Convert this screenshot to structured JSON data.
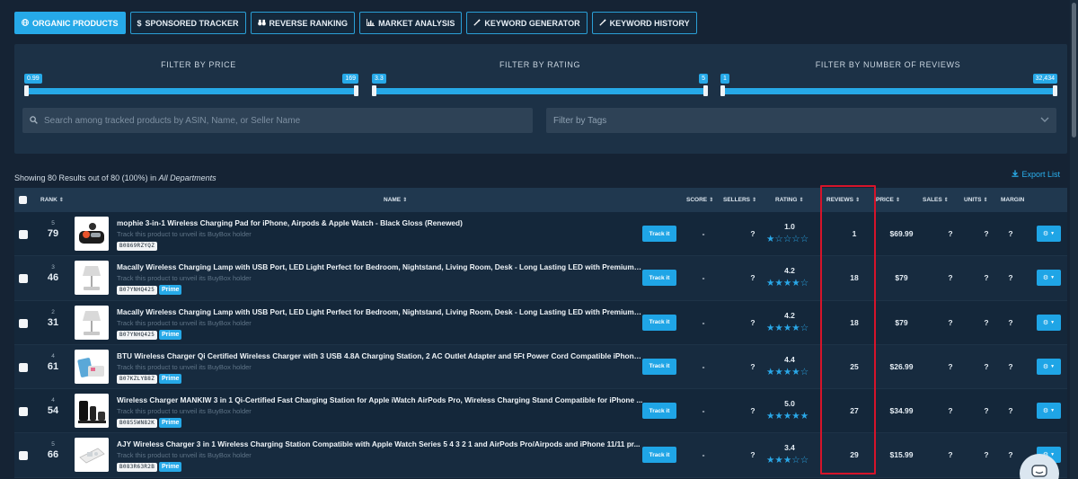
{
  "tabs": [
    {
      "label": "ORGANIC PRODUCTS",
      "icon": "globe-icon",
      "active": true
    },
    {
      "label": "SPONSORED TRACKER",
      "icon": "dollar-icon",
      "active": false
    },
    {
      "label": "REVERSE RANKING",
      "icon": "binoculars-icon",
      "active": false
    },
    {
      "label": "MARKET ANALYSIS",
      "icon": "bar-chart-icon",
      "active": false
    },
    {
      "label": "KEYWORD GENERATOR",
      "icon": "magic-wand-icon",
      "active": false
    },
    {
      "label": "KEYWORD HISTORY",
      "icon": "magic-wand-icon",
      "active": false
    }
  ],
  "filters": {
    "price": {
      "title": "FILTER BY PRICE",
      "min": "0.99",
      "max": "169"
    },
    "rating": {
      "title": "FILTER BY RATING",
      "min": "3.3",
      "max": "5"
    },
    "reviews": {
      "title": "FILTER BY NUMBER OF REVIEWS",
      "min": "1",
      "max": "32,434"
    }
  },
  "search": {
    "placeholder": "Search among tracked products by ASIN, Name, or Seller Name"
  },
  "tags": {
    "placeholder": "Filter by Tags"
  },
  "results": {
    "text": "Showing 80 Results out of 80 (100%) in ",
    "department": "All Departments"
  },
  "export_label": "Export List",
  "columns": {
    "rank": "RANK",
    "name": "NAME",
    "score": "SCORE",
    "sellers": "SELLERS",
    "rating": "RATING",
    "reviews": "REVIEWS",
    "price": "PRICE",
    "sales": "SALES",
    "units": "UNITS",
    "margin": "MARGIN"
  },
  "track_label": "Track it",
  "buybox_text": "Track this product to unveil its BuyBox holder",
  "prime_label": "Prime",
  "rows": [
    {
      "rank_small": "5",
      "rank": "79",
      "name": "mophie 3-in-1 Wireless Charging Pad for iPhone, Airpods & Apple Watch - Black Gloss (Renewed)",
      "asin": "B0869RZYQZ",
      "prime": false,
      "score": "-",
      "sellers": "?",
      "rating": "1.0",
      "stars": 1,
      "reviews": "1",
      "price": "$69.99",
      "sales": "?",
      "units": "?",
      "margin": "?"
    },
    {
      "rank_small": "3",
      "rank": "46",
      "name": "Macally Wireless Charging Lamp with USB Port, LED Light Perfect for Bedroom, Nightstand, Living Room, Desk - Long Lasting LED with Premium M...",
      "asin": "B07YNHQ425",
      "prime": true,
      "score": "-",
      "sellers": "?",
      "rating": "4.2",
      "stars": 4,
      "reviews": "18",
      "price": "$79",
      "sales": "?",
      "units": "?",
      "margin": "?"
    },
    {
      "rank_small": "2",
      "rank": "31",
      "name": "Macally Wireless Charging Lamp with USB Port, LED Light Perfect for Bedroom, Nightstand, Living Room, Desk - Long Lasting LED with Premium M...",
      "asin": "B07YNHQ425",
      "prime": true,
      "score": "-",
      "sellers": "?",
      "rating": "4.2",
      "stars": 4,
      "reviews": "18",
      "price": "$79",
      "sales": "?",
      "units": "?",
      "margin": "?"
    },
    {
      "rank_small": "4",
      "rank": "61",
      "name": "BTU Wireless Charger Qi Certified Wireless Charger with 3 USB 4.8A Charging Station, 2 AC Outlet Adapter and 5Ft Power Cord Compatible iPhone ...",
      "asin": "B07KZLYB8Z",
      "prime": true,
      "score": "-",
      "sellers": "?",
      "rating": "4.4",
      "stars": 4,
      "reviews": "25",
      "price": "$26.99",
      "sales": "?",
      "units": "?",
      "margin": "?"
    },
    {
      "rank_small": "4",
      "rank": "54",
      "name": "Wireless Charger MANKIW 3 in 1 Qi-Certified Fast Charging Station for Apple iWatch AirPods Pro, Wireless Charging Stand Compatible for iPhone ...",
      "asin": "B0855WN82K",
      "prime": true,
      "score": "-",
      "sellers": "?",
      "rating": "5.0",
      "stars": 5,
      "reviews": "27",
      "price": "$34.99",
      "sales": "?",
      "units": "?",
      "margin": "?"
    },
    {
      "rank_small": "5",
      "rank": "66",
      "name": "AJY Wireless Charger 3 in 1 Wireless Charging Station Compatible with Apple Watch Series 5 4 3 2 1 and AirPods Pro/Airpods and iPhone 11/11 pr...",
      "asin": "B083R63R2B",
      "prime": true,
      "score": "-",
      "sellers": "?",
      "rating": "3.4",
      "stars": 3,
      "reviews": "29",
      "price": "$15.99",
      "sales": "?",
      "units": "?",
      "margin": "?"
    }
  ],
  "colors": {
    "accent": "#26a9e8",
    "background": "#152334",
    "panel": "#1c3146",
    "highlight": "#d6142a"
  }
}
